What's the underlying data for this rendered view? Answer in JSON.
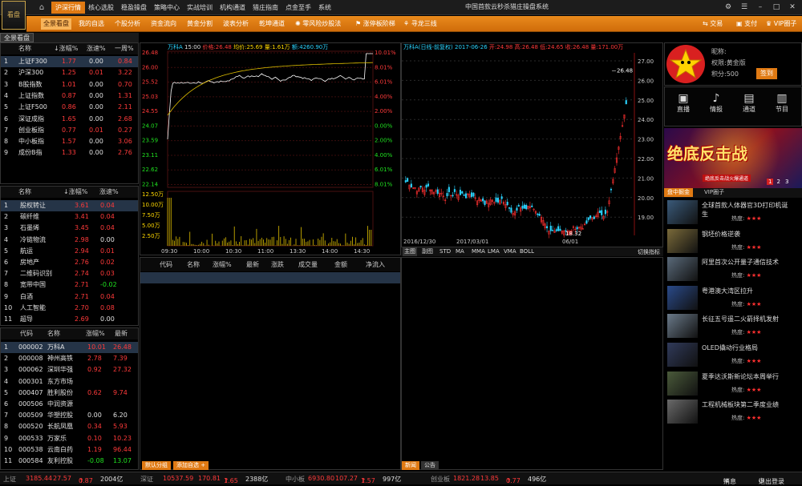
{
  "app": {
    "logo_text": "看盘",
    "title": "中国首款云秒杀猎庄操盘系统",
    "colors": {
      "accent": "#e07a13",
      "up": "#ff3a3a",
      "down": "#20e020",
      "even": "#e0e0e0"
    }
  },
  "main_tabs": [
    "沪深行情",
    "核心选股",
    "稳盈操盘",
    "策略中心",
    "实战培训",
    "机构通道",
    "猎庄指南",
    "点金至手",
    "系统"
  ],
  "sub_tabs": [
    "全景看盘",
    "我的自选",
    "个股分析",
    "资金流向",
    "黄金分割",
    "波表分析",
    "乾坤通道",
    "零风险炒股法",
    "涨停板阶梯",
    "寻龙三线"
  ],
  "right_buttons": [
    "交易",
    "支付",
    "VIP圈子"
  ],
  "left_header": "全景看盘",
  "index_table": {
    "headers": [
      "名称",
      "↓涨幅%",
      "涨速%",
      "一周%"
    ],
    "rows": [
      [
        "1",
        "上证F300",
        "1.77",
        "0.00",
        "0.84"
      ],
      [
        "2",
        "沪深300",
        "1.25",
        "0.01",
        "3.22"
      ],
      [
        "3",
        "B股指数",
        "1.01",
        "0.00",
        "0.70"
      ],
      [
        "4",
        "上证指数",
        "0.87",
        "0.00",
        "1.31"
      ],
      [
        "5",
        "上证F500",
        "0.86",
        "0.00",
        "2.11"
      ],
      [
        "6",
        "深证成指",
        "1.65",
        "0.00",
        "2.68"
      ],
      [
        "7",
        "创业板指",
        "0.77",
        "0.01",
        "0.27"
      ],
      [
        "8",
        "中小板指",
        "1.57",
        "0.00",
        "3.06"
      ],
      [
        "9",
        "成份B指",
        "1.33",
        "0.00",
        "2.76"
      ]
    ]
  },
  "sector_table": {
    "headers": [
      "名称",
      "↓涨幅%",
      "涨速%"
    ],
    "rows": [
      [
        "1",
        "股权转让",
        "3.61",
        "0.04"
      ],
      [
        "2",
        "碳纤维",
        "3.41",
        "0.04"
      ],
      [
        "3",
        "石墨烯",
        "3.45",
        "0.04"
      ],
      [
        "4",
        "冷链物流",
        "2.98",
        "0.00"
      ],
      [
        "5",
        "航运",
        "2.94",
        "0.01"
      ],
      [
        "6",
        "房地产",
        "2.76",
        "0.02"
      ],
      [
        "7",
        "二维码识别",
        "2.74",
        "0.03"
      ],
      [
        "8",
        "宽带中国",
        "2.71",
        "-0.02"
      ],
      [
        "9",
        "白酒",
        "2.71",
        "0.04"
      ],
      [
        "10",
        "人工智能",
        "2.70",
        "0.08"
      ],
      [
        "11",
        "超导",
        "2.69",
        "0.00"
      ]
    ]
  },
  "stock_table": {
    "headers": [
      "代码",
      "名称",
      "涨幅%",
      "最新"
    ],
    "rows": [
      [
        "1",
        "000002",
        "万科A",
        "10.01",
        "26.48"
      ],
      [
        "2",
        "000008",
        "神州高铁",
        "2.78",
        "7.39"
      ],
      [
        "3",
        "000062",
        "深圳华强",
        "0.92",
        "27.32"
      ],
      [
        "4",
        "000301",
        "东方市场",
        "",
        ""
      ],
      [
        "5",
        "000407",
        "胜利股份",
        "0.62",
        "9.74"
      ],
      [
        "6",
        "000506",
        "中润资源",
        "",
        ""
      ],
      [
        "7",
        "000509",
        "华塑控股",
        "0.00",
        "6.20"
      ],
      [
        "8",
        "000520",
        "长航凤凰",
        "0.34",
        "5.93"
      ],
      [
        "9",
        "000533",
        "万家乐",
        "0.10",
        "10.23"
      ],
      [
        "10",
        "000538",
        "云南白药",
        "1.19",
        "96.44"
      ],
      [
        "11",
        "000584",
        "友利控股",
        "-0.08",
        "13.07"
      ]
    ]
  },
  "intraday": {
    "name": "万科A",
    "time": "15:00",
    "price_label": "价格:26.48",
    "avg_label": "均价:25.69",
    "vol_label": "量:1.61万",
    "amount_label": "额:4260.90万",
    "left_axis": [
      "26.48",
      "26.00",
      "25.52",
      "25.03",
      "24.55",
      "24.07",
      "23.59",
      "23.11",
      "22.62",
      "22.14"
    ],
    "right_axis": [
      "10.01%",
      "8.01%",
      "6.01%",
      "4.00%",
      "2.00%",
      "0.00%",
      "2.00%",
      "4.00%",
      "6.01%",
      "8.01%"
    ],
    "vol_axis": [
      "12.50万",
      "10.00万",
      "7.50万",
      "5.00万",
      "2.50万"
    ],
    "time_axis": [
      "09:30",
      "10:00",
      "10:30",
      "11:00",
      "13:30",
      "14:00",
      "14:30"
    ]
  },
  "kline": {
    "title": "万科A(日线-前复权) 2017-06-26",
    "values_label": "开:24.98 高:26.48 低:24.65 收:26.48 量:171.00万",
    "right_axis": [
      "27.00",
      "26.00",
      "25.00",
      "24.00",
      "23.00",
      "22.00",
      "21.00",
      "20.00",
      "19.00"
    ],
    "date_axis": [
      "2016/12/30",
      "2017/03/01",
      "06/01"
    ],
    "high_label": "26.48",
    "low_label": "18.32",
    "indicator_tabs": [
      "主图",
      "副图",
      "STD",
      "MA",
      "MMA",
      "LMA",
      "VMA",
      "BOLL"
    ],
    "switch_label": "切换指标"
  },
  "quote_table": {
    "headers": [
      "代码",
      "名称",
      "涨幅%",
      "最新",
      "涨跌",
      "成交量",
      "金额",
      "净流入"
    ]
  },
  "bottom_left_tabs": [
    "默认分组",
    "添加自选 +"
  ],
  "bottom_mid_tabs": [
    "新闻",
    "公告"
  ],
  "user": {
    "nick_label": "昵称:",
    "nick_value": "",
    "level_label": "权限:",
    "level_value": "黄金版",
    "points_label": "积分:",
    "points_value": "500",
    "signin": "签到"
  },
  "user_icons": [
    "直播",
    "情报",
    "通道",
    "节目"
  ],
  "banner": {
    "text": "绝底反击战",
    "sub": "绝底反击战火爆通道",
    "pages": [
      "1",
      "2",
      "3"
    ]
  },
  "news_tabs": [
    "盘中掘金",
    "VIP圈子"
  ],
  "news": [
    {
      "title": "全球首款人体器官3D打印机诞",
      "title2": "生",
      "hot": "热度:"
    },
    {
      "title": "钢坯价格逆袭",
      "hot": "热度:"
    },
    {
      "title": "阿里首次公开量子通信技术",
      "hot": "热度:"
    },
    {
      "title": "粤港澳大湾区拉升",
      "hot": "热度:"
    },
    {
      "title": "长征五号遥二火箭择机发射",
      "hot": "热度:"
    },
    {
      "title": "OLED撬动行业格局",
      "hot": "热度:"
    },
    {
      "title": "夏季达沃斯新论坛本周举行",
      "hot": "热度:"
    },
    {
      "title": "工程机械板块第二季度业绩",
      "hot": "热度:"
    }
  ],
  "status": [
    {
      "name": "上证",
      "value": "3185.44",
      "chg": "27.57",
      "pct": "0.87",
      "amt": "2004亿"
    },
    {
      "name": "深证",
      "value": "10537.59",
      "chg": "170.81",
      "pct": "1.65",
      "amt": "2388亿"
    },
    {
      "name": "中小板",
      "value": "6930.80",
      "chg": "107.27",
      "pct": "1.57",
      "amt": "997亿"
    },
    {
      "name": "创业板",
      "value": "1821.28",
      "chg": "13.85",
      "pct": "0.77",
      "amt": "496亿"
    }
  ],
  "status_right": [
    "消息",
    "退出登录"
  ]
}
